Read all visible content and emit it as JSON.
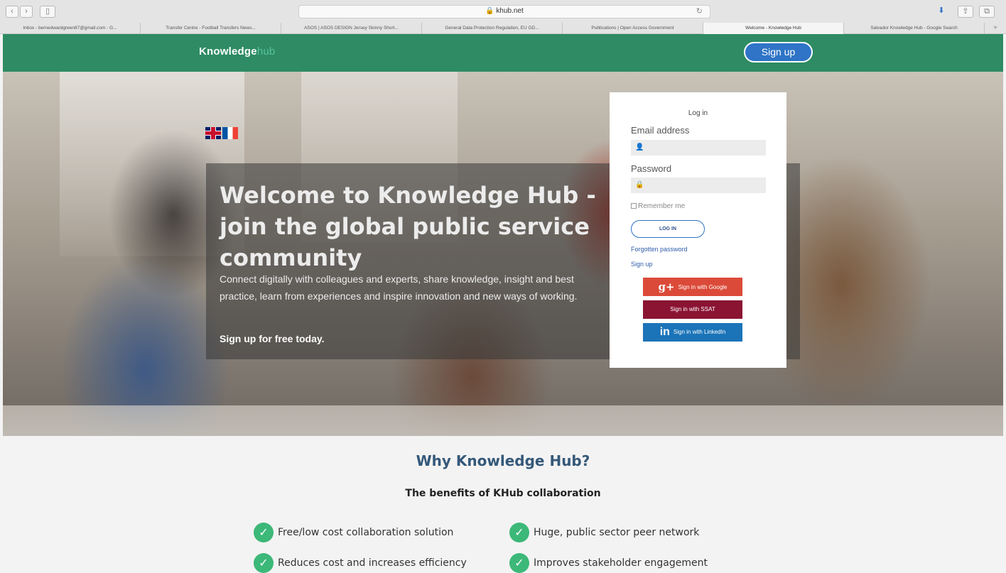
{
  "browser": {
    "url": "khub.net",
    "tabs": [
      "Inbox - bernedwardgreen87@gmail.com - G...",
      "Transfer Centre - Football Transfers News...",
      "ASOS | ASOS DESIGN Jersey Skinny Short...",
      "General Data Protection Regulation, EU GD...",
      "Publications | Open Access Government",
      "Welcome - Knowledge Hub",
      "Salvador Knowledge Hub - Google Search"
    ],
    "active_tab_index": 5
  },
  "header": {
    "logo_main": "Knowledge",
    "logo_accent": "hub",
    "signup_label": "Sign up"
  },
  "hero": {
    "title": "Welcome to Knowledge Hub - join the global public service community",
    "description": "Connect digitally with colleagues and experts, share knowledge, insight and best practice, learn from experiences and inspire innovation and new ways of working.",
    "cta": "Sign up for free today."
  },
  "login": {
    "title": "Log in",
    "email_label": "Email address",
    "password_label": "Password",
    "remember_label": "Remember me",
    "login_button": "LOG IN",
    "forgotten_link": "Forgotten password",
    "signup_link": "Sign up",
    "google_button": "Sign in with Google",
    "ssat_button": "Sign in with SSAT",
    "linkedin_button": "Sign in with LinkedIn"
  },
  "why": {
    "heading": "Why Knowledge Hub?",
    "subheading": "The benefits of KHub collaboration",
    "benefits": [
      "Free/low cost collaboration solution",
      "Huge, public sector peer network",
      "Reduces cost and increases efficiency",
      "Improves stakeholder engagement"
    ]
  },
  "colors": {
    "header_green": "#2e8b63",
    "accent_blue": "#2f74c6",
    "google_red": "#db4a39",
    "ssat_maroon": "#8b1433",
    "linkedin_blue": "#1b74b8",
    "check_green": "#3cb878",
    "heading_blue": "#355879"
  }
}
